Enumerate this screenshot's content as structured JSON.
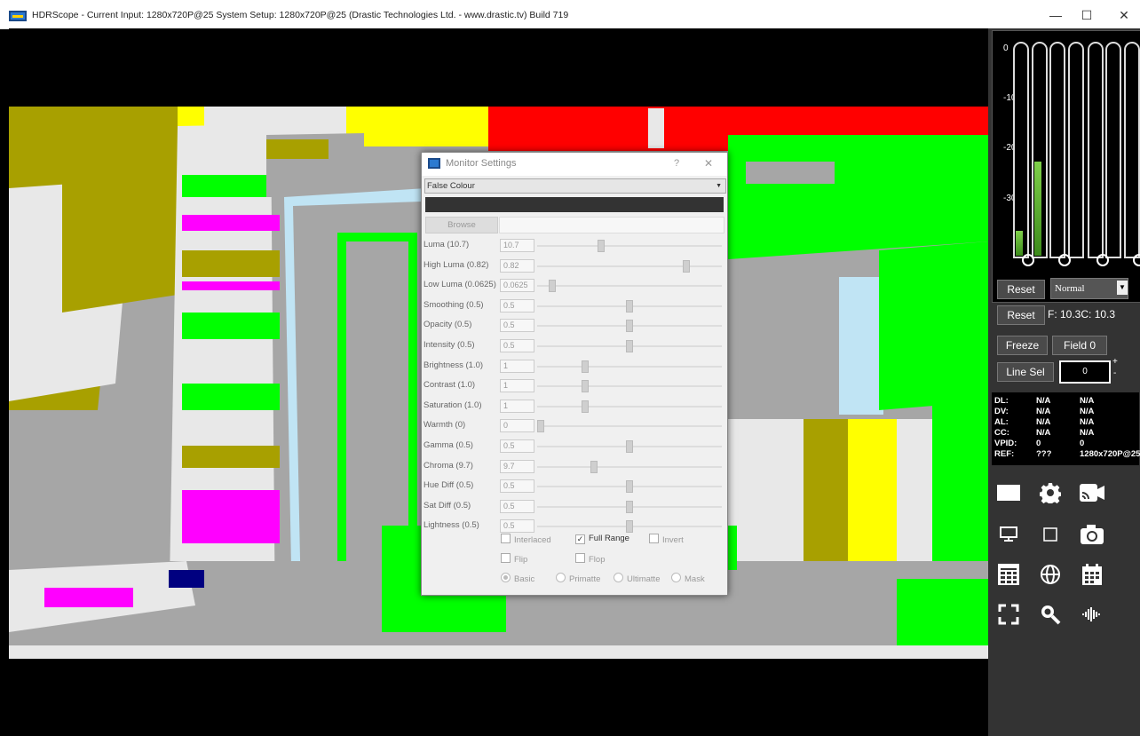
{
  "window": {
    "title": "HDRScope - Current Input: 1280x720P@25  System Setup: 1280x720P@25   (Drastic Technologies Ltd. - www.drastic.tv) Build 719",
    "min": "—",
    "max": "☐",
    "close": "✕"
  },
  "meters": {
    "scale": [
      "0",
      "-10",
      "-20",
      "-30"
    ],
    "levels": [
      0.12,
      0.45,
      0,
      0,
      0,
      0,
      0,
      0
    ]
  },
  "controls": {
    "reset1": "Reset",
    "mode": "Normal",
    "reset2": "Reset",
    "fc": "F: 10.3C: 10.3",
    "freeze": "Freeze",
    "field": "Field 0",
    "linesel": "Line Sel",
    "line_value": "0",
    "plus": "+",
    "minus": "-"
  },
  "info": {
    "rows": [
      {
        "k": "DL:",
        "v1": "N/A",
        "v2": "N/A"
      },
      {
        "k": "DV:",
        "v1": "N/A",
        "v2": "N/A"
      },
      {
        "k": "AL:",
        "v1": "N/A",
        "v2": "N/A"
      },
      {
        "k": "CC:",
        "v1": "N/A",
        "v2": "N/A"
      },
      {
        "k": "VPID:",
        "v1": "0",
        "v2": "0"
      },
      {
        "k": "REF:",
        "v1": "???",
        "v2": "1280x720P@25"
      }
    ]
  },
  "dialog": {
    "title": "Monitor Settings",
    "help": "?",
    "close": "✕",
    "mode": "False Colour",
    "browse": "Browse",
    "sliders": [
      {
        "label": "Luma (10.7)",
        "value": "10.7",
        "pos": 0.34
      },
      {
        "label": "High Luma (0.82)",
        "value": "0.82",
        "pos": 0.82
      },
      {
        "label": "Low Luma (0.0625)",
        "value": "0.0625",
        "pos": 0.0625
      },
      {
        "label": "Smoothing (0.5)",
        "value": "0.5",
        "pos": 0.5
      },
      {
        "label": "Opacity (0.5)",
        "value": "0.5",
        "pos": 0.5
      },
      {
        "label": "Intensity (0.5)",
        "value": "0.5",
        "pos": 0.5
      },
      {
        "label": "Brightness (1.0)",
        "value": "1",
        "pos": 0.25
      },
      {
        "label": "Contrast (1.0)",
        "value": "1",
        "pos": 0.25
      },
      {
        "label": "Saturation (1.0)",
        "value": "1",
        "pos": 0.25
      },
      {
        "label": "Warmth (0)",
        "value": "0",
        "pos": 0.0
      },
      {
        "label": "Gamma (0.5)",
        "value": "0.5",
        "pos": 0.5
      },
      {
        "label": "Chroma (9.7)",
        "value": "9.7",
        "pos": 0.3
      },
      {
        "label": "Hue Diff (0.5)",
        "value": "0.5",
        "pos": 0.5
      },
      {
        "label": "Sat Diff (0.5)",
        "value": "0.5",
        "pos": 0.5
      },
      {
        "label": "Lightness (0.5)",
        "value": "0.5",
        "pos": 0.5
      }
    ],
    "interlaced": "Interlaced",
    "fullrange": "Full Range",
    "invert": "Invert",
    "flip": "Flip",
    "flop": "Flop",
    "basic": "Basic",
    "primatte": "Primatte",
    "ultimatte": "Ultimatte",
    "mask": "Mask"
  },
  "colors": {
    "green": "#00ff00",
    "yellow": "#ffff00",
    "red": "#ff0000",
    "magenta": "#ff00ff",
    "olive": "#a8a000",
    "gray": "#a6a6a6",
    "lightgray": "#e8e8e8",
    "lightblue": "#c0e4f4",
    "navy": "#000080"
  }
}
